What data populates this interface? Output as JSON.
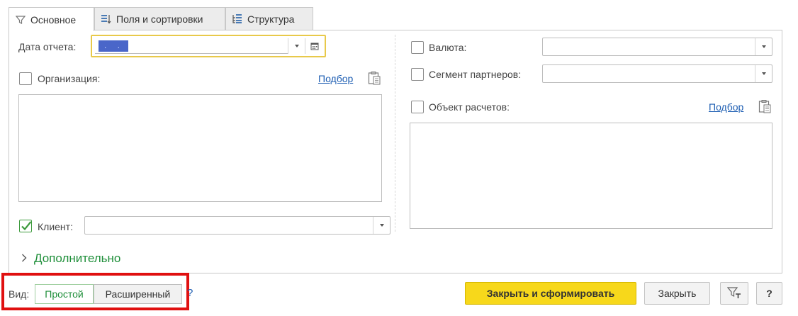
{
  "tabs": [
    {
      "label": "Основное",
      "icon": "filter-icon",
      "active": true
    },
    {
      "label": "Поля и сортировки",
      "icon": "fields-sort-icon",
      "active": false
    },
    {
      "label": "Структура",
      "icon": "structure-icon",
      "active": false
    }
  ],
  "left": {
    "report_date_label": "Дата отчета:",
    "report_date_value": ". .",
    "organization_label": "Организация:",
    "organization_checked": false,
    "organization_pick_link": "Подбор",
    "client_label": "Клиент:",
    "client_checked": true,
    "client_value": ""
  },
  "right": {
    "currency_label": "Валюта:",
    "currency_checked": false,
    "currency_value": "",
    "segment_label": "Сегмент партнеров:",
    "segment_checked": false,
    "segment_value": "",
    "object_label": "Объект расчетов:",
    "object_checked": false,
    "object_pick_link": "Подбор"
  },
  "more_label": "Дополнительно",
  "bottom": {
    "view_label": "Вид:",
    "view_options": [
      "Простой",
      "Расширенный"
    ],
    "view_selected": "Простой",
    "help_mark": "?",
    "close_and_build": "Закрыть и сформировать",
    "close": "Закрыть",
    "help_button": "?"
  },
  "colors": {
    "accent_green": "#1f8f3a",
    "primary_button": "#f7d81b",
    "link": "#1f5fb3",
    "highlight_border": "#e01010",
    "focus_border": "#e8c94a"
  }
}
